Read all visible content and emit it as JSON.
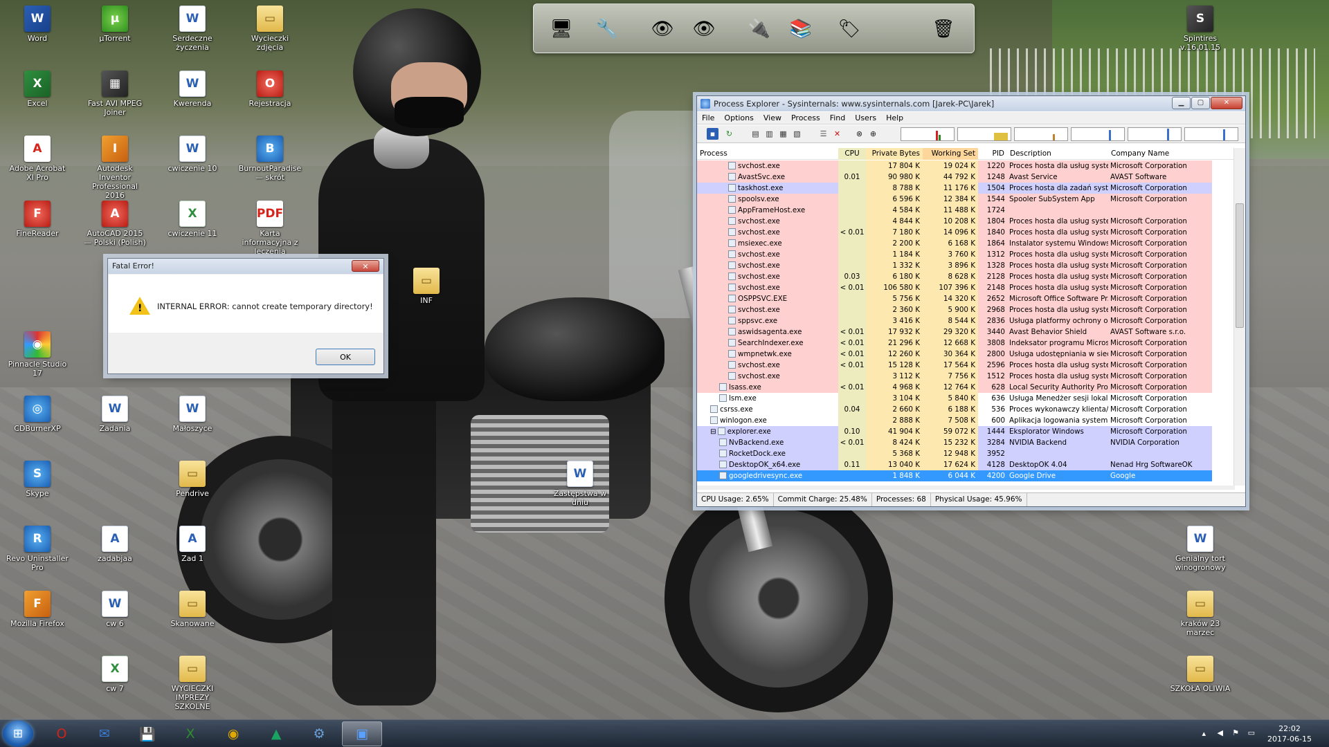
{
  "desktop_icons": [
    {
      "label": "Word",
      "icon": "word-icon",
      "badge": "W",
      "cls": "c-word"
    },
    {
      "label": "µTorrent",
      "icon": "utorrent-icon",
      "badge": "µ",
      "cls": "c-green"
    },
    {
      "label": "Serdeczne życzenia",
      "icon": "word-document-icon",
      "badge": "W",
      "cls": "c-doc"
    },
    {
      "label": "Wycieczki zdjęcia",
      "icon": "folder-icon",
      "badge": "▭",
      "cls": "c-folder"
    },
    {
      "label": "Excel",
      "icon": "excel-icon",
      "badge": "X",
      "cls": "c-excel"
    },
    {
      "label": "Fast AVI MPEG Joiner",
      "icon": "video-joiner-icon",
      "badge": "▦",
      "cls": "c-dark"
    },
    {
      "label": "Kwerenda",
      "icon": "word-document-icon",
      "badge": "W",
      "cls": "c-doc"
    },
    {
      "label": "Rejestracja",
      "icon": "opera-icon",
      "badge": "O",
      "cls": "c-red"
    },
    {
      "label": "Adobe Acrobat XI Pro",
      "icon": "acrobat-icon",
      "badge": "A",
      "cls": "c-pdf"
    },
    {
      "label": "Autodesk Inventor Professional 2016",
      "icon": "inventor-icon",
      "badge": "I",
      "cls": "c-orange"
    },
    {
      "label": "cwiczenie 10",
      "icon": "word-document-icon",
      "badge": "W",
      "cls": "c-doc"
    },
    {
      "label": "BurnoutParadise — skrót",
      "icon": "game-icon",
      "badge": "B",
      "cls": "c-blue"
    },
    {
      "label": "FineReader",
      "icon": "finereader-icon",
      "badge": "F",
      "cls": "c-red"
    },
    {
      "label": "AutoCAD 2015 — Polski (Polish)",
      "icon": "autocad-icon",
      "badge": "A",
      "cls": "c-red"
    },
    {
      "label": "cwiczenie 11",
      "icon": "excel-document-icon",
      "badge": "X",
      "cls": "c-xls"
    },
    {
      "label": "Karta informacyjna z leczenia szpitalnego",
      "icon": "pdf-icon",
      "badge": "PDF",
      "cls": "c-pdf"
    },
    {
      "label": "INF",
      "icon": "folder-icon",
      "badge": "▭",
      "cls": "c-folder"
    },
    {
      "label": "Pinnacle Studio 17",
      "icon": "pinnacle-icon",
      "badge": "◉",
      "cls": "c-multi"
    },
    {
      "label": "CDBurnerXP",
      "icon": "cdburner-icon",
      "badge": "◎",
      "cls": "c-blue"
    },
    {
      "label": "Zadania",
      "icon": "word-document-icon",
      "badge": "W",
      "cls": "c-doc"
    },
    {
      "label": "Małoszyce",
      "icon": "word-document-icon",
      "badge": "W",
      "cls": "c-doc"
    },
    {
      "label": "Skype",
      "icon": "skype-icon",
      "badge": "S",
      "cls": "c-blue"
    },
    {
      "label": "Pendrive",
      "icon": "folder-icon",
      "badge": "▭",
      "cls": "c-folder"
    },
    {
      "label": "Zastępstwa w dniu",
      "icon": "word-document-icon",
      "badge": "W",
      "cls": "c-doc"
    },
    {
      "label": "Revo Uninstaller Pro",
      "icon": "revo-icon",
      "badge": "R",
      "cls": "c-blue"
    },
    {
      "label": "zadabjaa",
      "icon": "access-document-icon",
      "badge": "A",
      "cls": "c-doc"
    },
    {
      "label": "Zad 1",
      "icon": "access-document-icon",
      "badge": "A",
      "cls": "c-doc"
    },
    {
      "label": "Mozilla Firefox",
      "icon": "firefox-icon",
      "badge": "F",
      "cls": "c-orange"
    },
    {
      "label": "cw 6",
      "icon": "word-document-icon",
      "badge": "W",
      "cls": "c-doc"
    },
    {
      "label": "Skanowane",
      "icon": "folder-icon",
      "badge": "▭",
      "cls": "c-folder"
    },
    {
      "label": "cw 7",
      "icon": "excel-document-icon",
      "badge": "X",
      "cls": "c-xls"
    },
    {
      "label": "WYCIECZKI IMPREZY SZKOLNE",
      "icon": "folder-icon",
      "badge": "▭",
      "cls": "c-folder"
    },
    {
      "label": "Spintires v.16.01.15",
      "icon": "game-icon",
      "badge": "S",
      "cls": "c-dark"
    },
    {
      "label": "Genialny tort winogronowy",
      "icon": "word-document-icon",
      "badge": "W",
      "cls": "c-doc"
    },
    {
      "label": "kraków 23 marzec",
      "icon": "folder-icon",
      "badge": "▭",
      "cls": "c-folder"
    },
    {
      "label": "SZKOŁA OLIWIA",
      "icon": "folder-icon",
      "badge": "▭",
      "cls": "c-folder"
    }
  ],
  "dock": [
    {
      "name": "monitor-icon",
      "glyph": "🖥"
    },
    {
      "name": "tools-icon",
      "glyph": "🔧"
    },
    {
      "name": "eye-icon",
      "glyph": "👁"
    },
    {
      "name": "eye-icon",
      "glyph": "👁"
    },
    {
      "name": "network-cable-icon",
      "glyph": "🔌"
    },
    {
      "name": "binders-icon",
      "glyph": "📚"
    },
    {
      "name": "stamp-icon",
      "glyph": "🏷"
    },
    {
      "name": "recycle-bin-icon",
      "glyph": "🗑"
    }
  ],
  "dialog": {
    "title": "Fatal Error!",
    "close": "✕",
    "message": "INTERNAL ERROR: cannot create temporary directory!",
    "ok": "OK"
  },
  "procexp": {
    "title": "Process Explorer - Sysinternals: www.sysinternals.com [Jarek-PC\\Jarek]",
    "menu": [
      "File",
      "Options",
      "View",
      "Process",
      "Find",
      "Users",
      "Help"
    ],
    "columns": {
      "process": "Process",
      "cpu": "CPU",
      "private": "Private Bytes",
      "working": "Working Set",
      "pid": "PID",
      "desc": "Description",
      "company": "Company Name"
    },
    "colors": {
      "service": "#ffd0d0",
      "own": "#d0d0ff",
      "selected": "#3399ff",
      "cpu_col": "#ececbe",
      "private_col": "#fde8b0",
      "ws_col": "#fde8b0"
    },
    "rows": [
      {
        "indent": 3,
        "name": "svchost.exe",
        "cpu": "",
        "pb": "17 804 K",
        "ws": "19 024 K",
        "pid": "1220",
        "desc": "Proces hosta dla usług syste...",
        "comp": "Microsoft Corporation",
        "type": "service"
      },
      {
        "indent": 3,
        "name": "AvastSvc.exe",
        "cpu": "0.01",
        "pb": "90 980 K",
        "ws": "44 792 K",
        "pid": "1248",
        "desc": "Avast Service",
        "comp": "AVAST Software",
        "type": "service"
      },
      {
        "indent": 3,
        "name": "taskhost.exe",
        "cpu": "",
        "pb": "8 788 K",
        "ws": "11 176 K",
        "pid": "1504",
        "desc": "Proces hosta dla zadań syst...",
        "comp": "Microsoft Corporation",
        "type": "own"
      },
      {
        "indent": 3,
        "name": "spoolsv.exe",
        "cpu": "",
        "pb": "6 596 K",
        "ws": "12 384 K",
        "pid": "1544",
        "desc": "Spooler SubSystem App",
        "comp": "Microsoft Corporation",
        "type": "service"
      },
      {
        "indent": 3,
        "name": "AppFrameHost.exe",
        "cpu": "",
        "pb": "4 584 K",
        "ws": "11 488 K",
        "pid": "1724",
        "desc": "",
        "comp": "",
        "type": "service"
      },
      {
        "indent": 3,
        "name": "svchost.exe",
        "cpu": "",
        "pb": "4 844 K",
        "ws": "10 208 K",
        "pid": "1804",
        "desc": "Proces hosta dla usług syste...",
        "comp": "Microsoft Corporation",
        "type": "service"
      },
      {
        "indent": 3,
        "name": "svchost.exe",
        "cpu": "< 0.01",
        "pb": "7 180 K",
        "ws": "14 096 K",
        "pid": "1840",
        "desc": "Proces hosta dla usług syste...",
        "comp": "Microsoft Corporation",
        "type": "service"
      },
      {
        "indent": 3,
        "name": "msiexec.exe",
        "cpu": "",
        "pb": "2 200 K",
        "ws": "6 168 K",
        "pid": "1864",
        "desc": "Instalator systemu Windows®",
        "comp": "Microsoft Corporation",
        "type": "service"
      },
      {
        "indent": 3,
        "name": "svchost.exe",
        "cpu": "",
        "pb": "1 184 K",
        "ws": "3 760 K",
        "pid": "1312",
        "desc": "Proces hosta dla usług syste...",
        "comp": "Microsoft Corporation",
        "type": "service"
      },
      {
        "indent": 3,
        "name": "svchost.exe",
        "cpu": "",
        "pb": "1 332 K",
        "ws": "3 896 K",
        "pid": "1328",
        "desc": "Proces hosta dla usług syste...",
        "comp": "Microsoft Corporation",
        "type": "service"
      },
      {
        "indent": 3,
        "name": "svchost.exe",
        "cpu": "0.03",
        "pb": "6 180 K",
        "ws": "8 628 K",
        "pid": "2128",
        "desc": "Proces hosta dla usług syste...",
        "comp": "Microsoft Corporation",
        "type": "service"
      },
      {
        "indent": 3,
        "name": "svchost.exe",
        "cpu": "< 0.01",
        "pb": "106 580 K",
        "ws": "107 396 K",
        "pid": "2148",
        "desc": "Proces hosta dla usług syste...",
        "comp": "Microsoft Corporation",
        "type": "service"
      },
      {
        "indent": 3,
        "name": "OSPPSVC.EXE",
        "cpu": "",
        "pb": "5 756 K",
        "ws": "14 320 K",
        "pid": "2652",
        "desc": "Microsoft Office Software Pr...",
        "comp": "Microsoft Corporation",
        "type": "service"
      },
      {
        "indent": 3,
        "name": "svchost.exe",
        "cpu": "",
        "pb": "2 360 K",
        "ws": "5 900 K",
        "pid": "2968",
        "desc": "Proces hosta dla usług syste...",
        "comp": "Microsoft Corporation",
        "type": "service"
      },
      {
        "indent": 3,
        "name": "sppsvc.exe",
        "cpu": "",
        "pb": "3 416 K",
        "ws": "8 544 K",
        "pid": "2836",
        "desc": "Usługa platformy ochrony op...",
        "comp": "Microsoft Corporation",
        "type": "service"
      },
      {
        "indent": 3,
        "name": "aswidsagenta.exe",
        "cpu": "< 0.01",
        "pb": "17 932 K",
        "ws": "29 320 K",
        "pid": "3440",
        "desc": "Avast Behavior Shield",
        "comp": "AVAST Software s.r.o.",
        "type": "service"
      },
      {
        "indent": 3,
        "name": "SearchIndexer.exe",
        "cpu": "< 0.01",
        "pb": "21 296 K",
        "ws": "12 668 K",
        "pid": "3808",
        "desc": "Indeksator programu Microso...",
        "comp": "Microsoft Corporation",
        "type": "service"
      },
      {
        "indent": 3,
        "name": "wmpnetwk.exe",
        "cpu": "< 0.01",
        "pb": "12 260 K",
        "ws": "30 364 K",
        "pid": "2800",
        "desc": "Usługa udostępniania w siec...",
        "comp": "Microsoft Corporation",
        "type": "service"
      },
      {
        "indent": 3,
        "name": "svchost.exe",
        "cpu": "< 0.01",
        "pb": "15 128 K",
        "ws": "17 564 K",
        "pid": "2596",
        "desc": "Proces hosta dla usług syste...",
        "comp": "Microsoft Corporation",
        "type": "service"
      },
      {
        "indent": 3,
        "name": "svchost.exe",
        "cpu": "",
        "pb": "3 112 K",
        "ws": "7 756 K",
        "pid": "1512",
        "desc": "Proces hosta dla usług syste...",
        "comp": "Microsoft Corporation",
        "type": "service"
      },
      {
        "indent": 2,
        "name": "lsass.exe",
        "cpu": "< 0.01",
        "pb": "4 968 K",
        "ws": "12 764 K",
        "pid": "628",
        "desc": "Local Security Authority Proc...",
        "comp": "Microsoft Corporation",
        "type": "service"
      },
      {
        "indent": 2,
        "name": "lsm.exe",
        "cpu": "",
        "pb": "3 104 K",
        "ws": "5 840 K",
        "pid": "636",
        "desc": "Usługa Menedżer sesji lokal...",
        "comp": "Microsoft Corporation",
        "type": "normal"
      },
      {
        "indent": 1,
        "name": "csrss.exe",
        "cpu": "0.04",
        "pb": "2 660 K",
        "ws": "6 188 K",
        "pid": "536",
        "desc": "Proces wykonawczy klienta/...",
        "comp": "Microsoft Corporation",
        "type": "normal"
      },
      {
        "indent": 1,
        "name": "winlogon.exe",
        "cpu": "",
        "pb": "2 888 K",
        "ws": "7 508 K",
        "pid": "600",
        "desc": "Aplikacja logowania systemu...",
        "comp": "Microsoft Corporation",
        "type": "normal"
      },
      {
        "indent": 1,
        "name": "explorer.exe",
        "cpu": "0.10",
        "pb": "41 904 K",
        "ws": "59 072 K",
        "pid": "1444",
        "desc": "Eksplorator Windows",
        "comp": "Microsoft Corporation",
        "type": "own",
        "tree": "⊟"
      },
      {
        "indent": 2,
        "name": "NvBackend.exe",
        "cpu": "< 0.01",
        "pb": "8 424 K",
        "ws": "15 232 K",
        "pid": "3284",
        "desc": "NVIDIA Backend",
        "comp": "NVIDIA Corporation",
        "type": "own"
      },
      {
        "indent": 2,
        "name": "RocketDock.exe",
        "cpu": "",
        "pb": "5 368 K",
        "ws": "12 948 K",
        "pid": "3952",
        "desc": "",
        "comp": "",
        "type": "own"
      },
      {
        "indent": 2,
        "name": "DesktopOK_x64.exe",
        "cpu": "0.11",
        "pb": "13 040 K",
        "ws": "17 624 K",
        "pid": "4128",
        "desc": "DesktopOK 4.04",
        "comp": "Nenad Hrg SoftwareOK",
        "type": "own"
      },
      {
        "indent": 2,
        "name": "googledrivesync.exe",
        "cpu": "",
        "pb": "1 848 K",
        "ws": "6 044 K",
        "pid": "4200",
        "desc": "Google Drive",
        "comp": "Google",
        "type": "selected"
      }
    ],
    "status": {
      "cpu": "CPU Usage: 2.65%",
      "commit": "Commit Charge: 25.48%",
      "procs": "Processes: 68",
      "phys": "Physical Usage: 45.96%"
    }
  },
  "taskbar": {
    "items": [
      {
        "name": "opera-taskbar-icon",
        "glyph": "O",
        "color": "#d0231a"
      },
      {
        "name": "thunderbird-taskbar-icon",
        "glyph": "✉",
        "color": "#3a7bd5"
      },
      {
        "name": "save-disk-taskbar-icon",
        "glyph": "💾",
        "color": "#1a4f9e"
      },
      {
        "name": "xara-taskbar-icon",
        "glyph": "X",
        "color": "#2e8f2e"
      },
      {
        "name": "chrome-taskbar-icon",
        "glyph": "◉",
        "color": "#e0a800"
      },
      {
        "name": "google-drive-taskbar-icon",
        "glyph": "▲",
        "color": "#1aa260"
      },
      {
        "name": "control-panel-taskbar-icon",
        "glyph": "⚙",
        "color": "#6aa0d8"
      },
      {
        "name": "process-explorer-taskbar-icon",
        "glyph": "▣",
        "color": "#5aa0ff",
        "active": true
      }
    ],
    "time": "22:02",
    "date": "2017-06-15"
  }
}
